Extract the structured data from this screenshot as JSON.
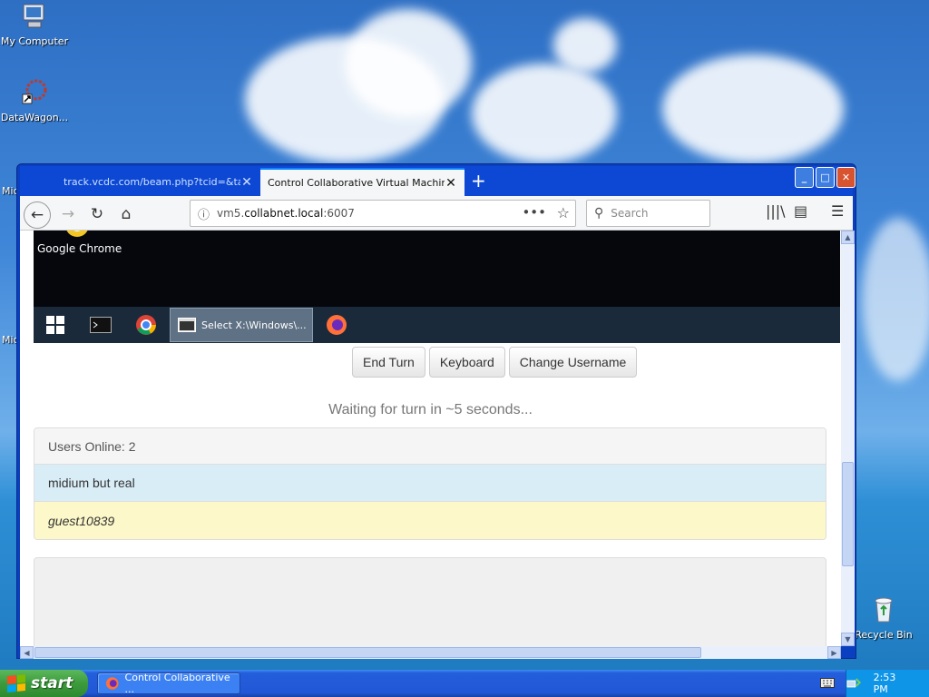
{
  "desktop": {
    "icons": [
      {
        "label": "My Computer",
        "icon": "my-computer-icon"
      },
      {
        "label": "DataWagon...",
        "icon": "datawagon-icon"
      }
    ],
    "partial_labels": [
      "Mic",
      "Mic"
    ],
    "recycle_bin": "Recycle Bin"
  },
  "browser": {
    "tabs": [
      {
        "title": "track.vcdc.com/beam.php?tcid=&targ",
        "active": false
      },
      {
        "title": "Control Collaborative Virtual Machines!",
        "active": true
      }
    ],
    "url": {
      "prefix": "vm5.",
      "host": "collabnet.local",
      "suffix": ":6007"
    },
    "search_placeholder": "Search"
  },
  "remote": {
    "desktop_label": "Google Chrome",
    "active_window": "Select X:\\Windows\\..."
  },
  "controls": {
    "end_turn": "End Turn",
    "keyboard": "Keyboard",
    "change_username": "Change Username"
  },
  "status": "Waiting for turn in ~5 seconds...",
  "users": {
    "header": "Users Online: 2",
    "list": [
      "midium but real",
      "guest10839"
    ]
  },
  "taskbar": {
    "start": "start",
    "window_button": "Control Collaborative ...",
    "clock": "2:53 PM"
  },
  "colors": {
    "taskbar": "#245edb",
    "start": "#3c9a3c",
    "user_active": "#d9edf7",
    "user_guest": "#fcf8c9"
  }
}
